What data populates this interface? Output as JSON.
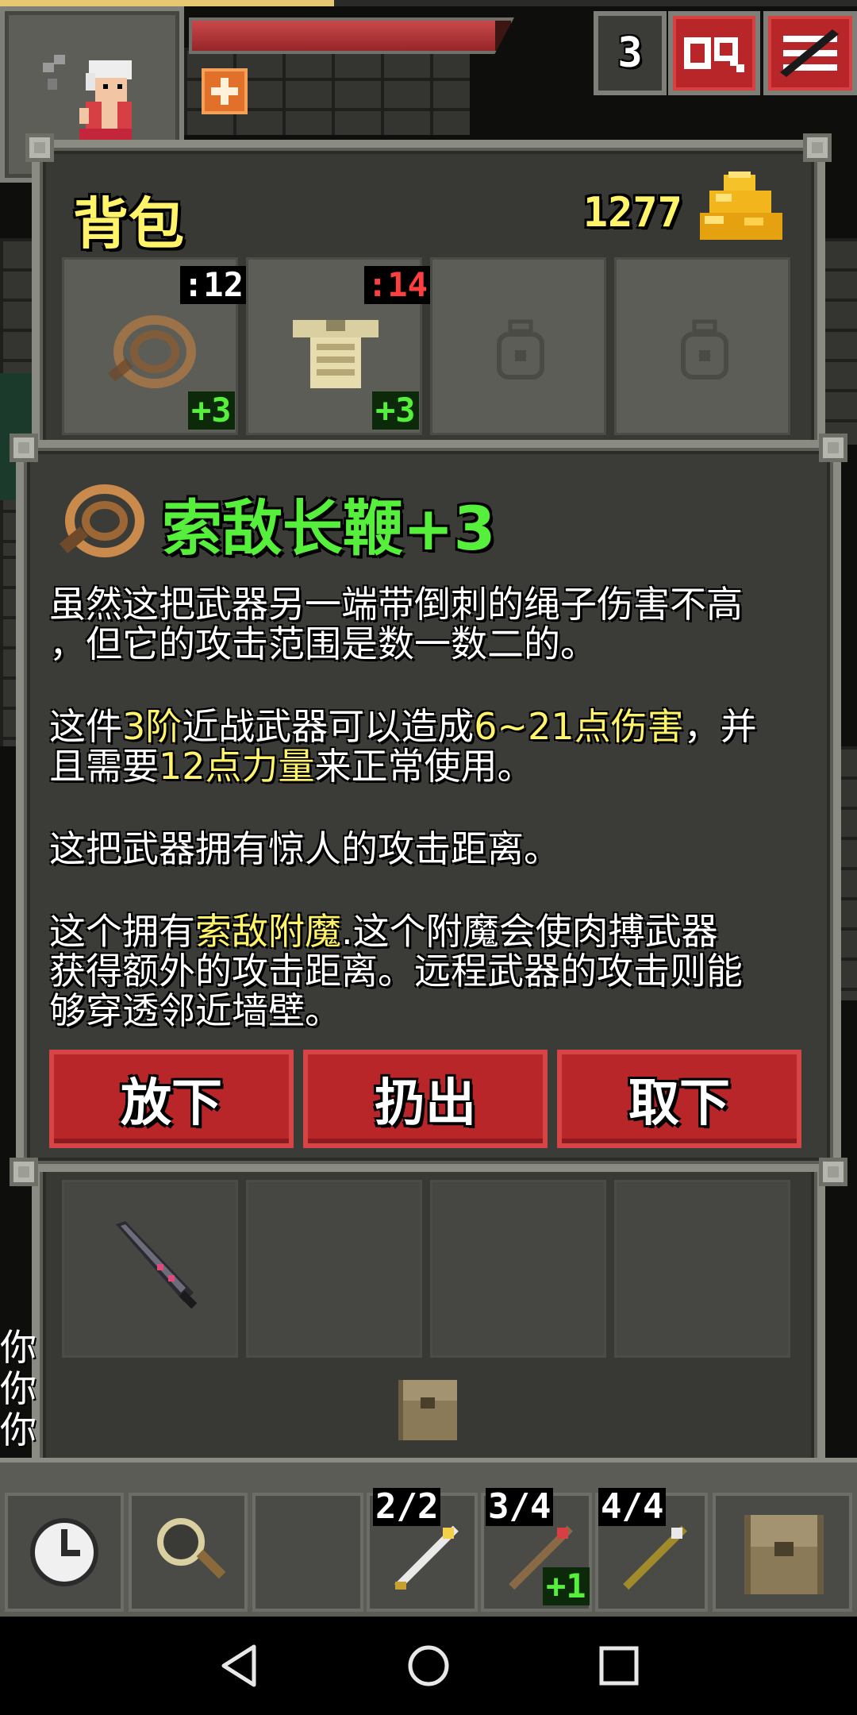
{
  "hud": {
    "depth": "3",
    "journal_icon": "journal-icon",
    "menu_icon": "menu-icon",
    "xp_fraction": 0.39,
    "hp_fraction": 0.95
  },
  "backpack": {
    "title": "背包",
    "gold": "1277",
    "equip_slots": [
      {
        "icon": "whip-icon",
        "str_req": ":12",
        "bonus": "+3"
      },
      {
        "icon": "armor-icon",
        "str_req": ":14",
        "bonus": "+3"
      },
      {
        "icon": "ring-placeholder-icon"
      },
      {
        "icon": "ring-placeholder-icon"
      }
    ]
  },
  "item": {
    "name": "索敌长鞭+3",
    "lines": [
      "虽然这把武器另一端带倒刺的绳子伤害不高",
      "，但它的攻击范围是数一数二的。",
      "这把武器拥有惊人的攻击距离。",
      "获得额外的攻击距离。远程武器的攻击则能",
      "够穿透邻近墙壁。"
    ],
    "tier_line": {
      "p1": "这件",
      "tier": "3阶",
      "p2": "近战武器可以造成",
      "damage": "6~21点伤害",
      "p3": "，并"
    },
    "str_line": {
      "p1": "且需要",
      "strength": "12点力量",
      "p2": "来正常使用。"
    },
    "enchant_line": {
      "p1": "这个拥有",
      "enchant": "索敌附魔",
      "p2": ".这个附魔会使肉搏武器"
    },
    "actions": {
      "drop": "放下",
      "throw": "扔出",
      "unequip": "取下"
    }
  },
  "log": [
    "你",
    "你",
    "你"
  ],
  "toolbar": {
    "wait_icon": "clock-icon",
    "search_icon": "magnifier-icon",
    "quickslots": [
      {
        "icon": "wand-icon",
        "charges": "2/2"
      },
      {
        "icon": "wand-icon",
        "charges": "3/4",
        "bonus": "+1"
      },
      {
        "icon": "wand-icon",
        "charges": "4/4"
      }
    ],
    "inventory_icon": "backpack-icon"
  },
  "colors": {
    "title_yellow": "#fff36a",
    "item_green": "#55ef3c",
    "button_red": "#b8262a",
    "strength_red": "#ff3f3f"
  }
}
